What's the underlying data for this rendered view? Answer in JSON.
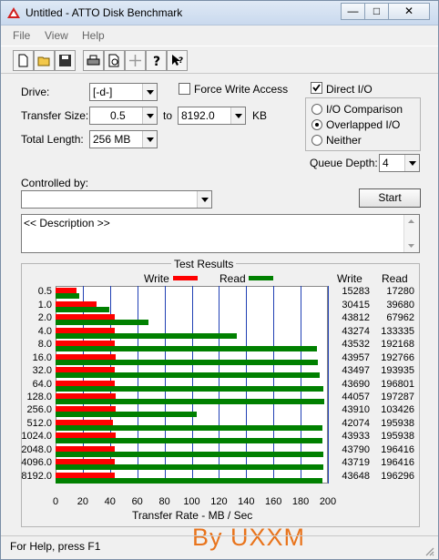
{
  "window": {
    "title": "Untitled - ATTO Disk Benchmark",
    "controls": {
      "minimize": "—",
      "maximize": "□",
      "close": "✕"
    }
  },
  "menu": [
    "File",
    "View",
    "Help"
  ],
  "settings": {
    "drive_label": "Drive:",
    "drive_value": "[-d-]",
    "force_write_label": "Force Write Access",
    "direct_io_label": "Direct I/O",
    "transfer_size_label": "Transfer Size:",
    "transfer_from": "0.5",
    "to_label": "to",
    "transfer_to": "8192.0",
    "kb_label": "KB",
    "total_length_label": "Total Length:",
    "total_length_value": "256 MB",
    "io_comparison": "I/O Comparison",
    "overlapped_io": "Overlapped I/O",
    "neither": "Neither",
    "queue_depth_label": "Queue Depth:",
    "queue_depth_value": "4",
    "controlled_by_label": "Controlled by:",
    "start_label": "Start",
    "description": "<< Description >>"
  },
  "results": {
    "title": "Test Results",
    "write_legend": "Write",
    "read_legend": "Read",
    "write_col": "Write",
    "read_col": "Read",
    "axis_label": "Transfer Rate - MB / Sec",
    "colors": {
      "write": "#ff0000",
      "read": "#008000",
      "grid": "#1f3fb4"
    }
  },
  "chart_data": {
    "type": "bar",
    "categories": [
      "0.5",
      "1.0",
      "2.0",
      "4.0",
      "8.0",
      "16.0",
      "32.0",
      "64.0",
      "128.0",
      "256.0",
      "512.0",
      "1024.0",
      "2048.0",
      "4096.0",
      "8192.0"
    ],
    "series": [
      {
        "name": "Write",
        "values": [
          15283,
          30415,
          43812,
          43274,
          43532,
          43957,
          43497,
          43690,
          44057,
          43910,
          42074,
          43933,
          43790,
          43719,
          43648
        ]
      },
      {
        "name": "Read",
        "values": [
          17280,
          39680,
          67962,
          133335,
          192168,
          192766,
          193935,
          196801,
          197287,
          103426,
          195938,
          195938,
          196416,
          196416,
          196296
        ]
      }
    ],
    "x_ticks": [
      "0",
      "20",
      "40",
      "60",
      "80",
      "100",
      "120",
      "140",
      "160",
      "180",
      "200"
    ],
    "xlim": [
      0,
      200
    ],
    "xlabel": "Transfer Rate - MB / Sec"
  },
  "status_text": "For Help, press F1",
  "watermark": "By UXXM"
}
